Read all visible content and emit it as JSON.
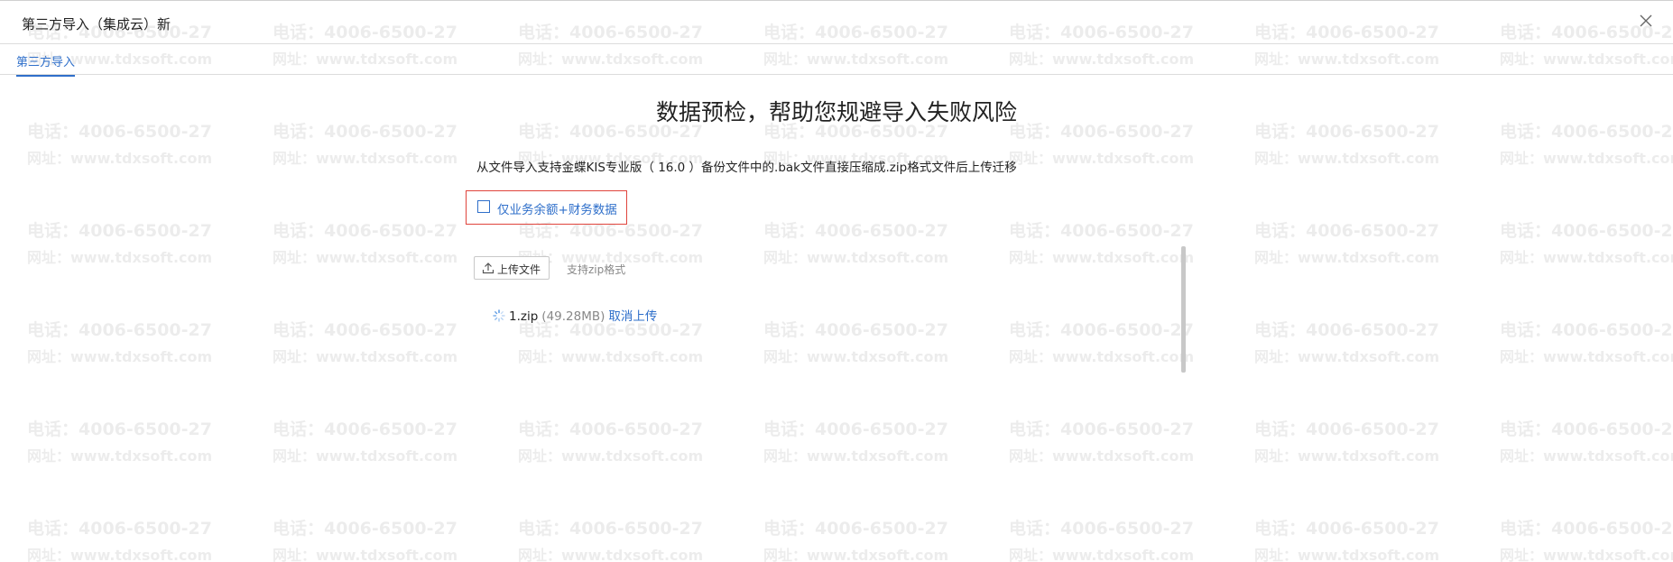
{
  "window": {
    "title": "第三方导入（集成云）新"
  },
  "tabs": [
    {
      "label": "第三方导入"
    }
  ],
  "main": {
    "heading": "数据预检，帮助您规避导入失败风险",
    "instruction": "从文件导入支持金蝶KIS专业版（ 16.0 ）备份文件中的.bak文件直接压缩成.zip格式文件后上传迁移",
    "option_label": "仅业务余额+财务数据",
    "option_checked": false,
    "upload_label": "上传文件",
    "format_hint": "支持zip格式",
    "file": {
      "name": "1.zip",
      "size": "(49.28MB)",
      "cancel_label": "取消上传"
    }
  },
  "watermark": {
    "phone": "电话：4006-6500-27",
    "site": "网址：www.tdxsoft.com"
  },
  "colors": {
    "accent": "#2f6fca",
    "highlight_border": "#e0443c",
    "divider": "#dcdcdc"
  },
  "icons": {
    "close": "close-icon",
    "upload": "upload-icon",
    "loading": "loading-spinner-icon"
  }
}
